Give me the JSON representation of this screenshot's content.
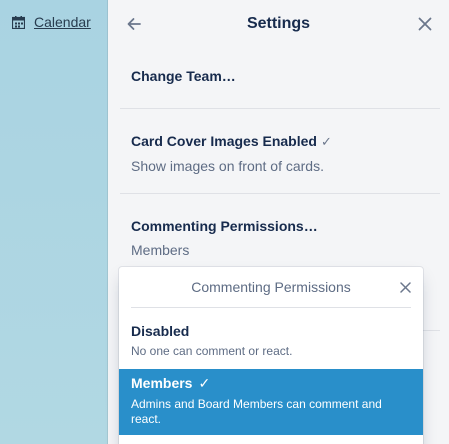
{
  "sidebar": {
    "calendar_icon": "calendar-icon",
    "calendar_label": "Calendar"
  },
  "settings": {
    "title": "Settings",
    "back_icon": "arrow-left-icon",
    "close_icon": "close-icon",
    "change_team": "Change Team…",
    "card_covers_title": "Card Cover Images Enabled",
    "card_covers_check": "✓",
    "card_covers_desc": "Show images on front of cards.",
    "commenting_title": "Commenting Permissions…",
    "commenting_value": "Members"
  },
  "popover": {
    "title": "Commenting Permissions",
    "close_icon": "close-icon",
    "options": [
      {
        "title": "Disabled",
        "desc": "No one can comment or react.",
        "selected": false
      },
      {
        "title": "Members",
        "check": "✓",
        "desc": "Admins and Board Members can comment and react.",
        "selected": true
      }
    ]
  },
  "colors": {
    "accent_selected": "#298fca",
    "panel_bg": "#f4f5f7",
    "board_bg": "#abd0dd"
  }
}
